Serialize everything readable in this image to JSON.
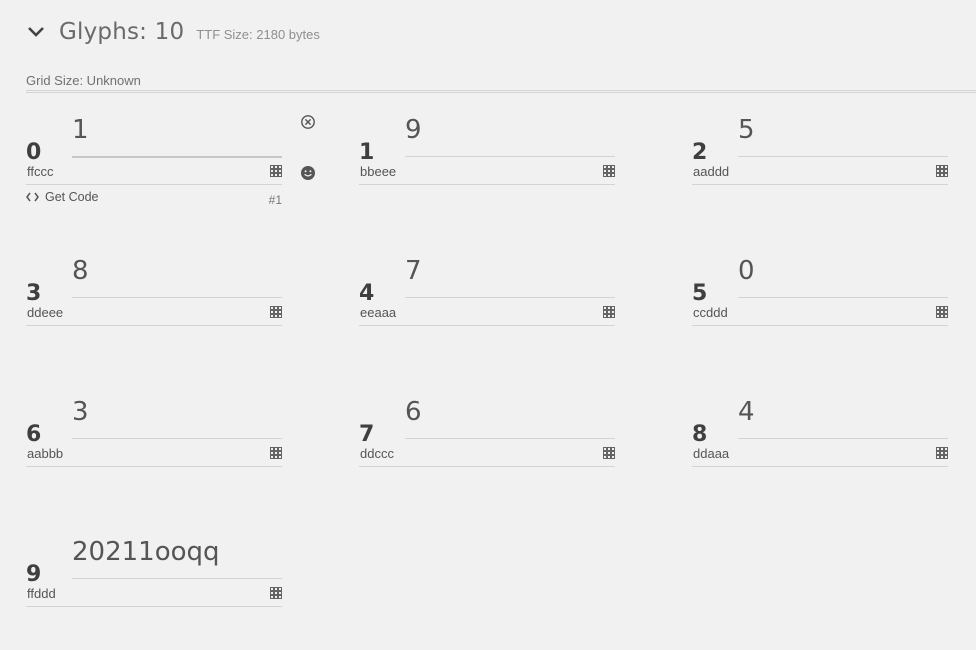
{
  "header": {
    "title": "Glyphs: 10",
    "ttf_size": "TTF Size: 2180 bytes",
    "grid_size": "Grid Size: Unknown"
  },
  "glyphs": [
    {
      "index": "0",
      "char": "1",
      "name": "ffccc",
      "get_code": "Get Code",
      "number": "#1"
    },
    {
      "index": "1",
      "char": "9",
      "name": "bbeee"
    },
    {
      "index": "2",
      "char": "5",
      "name": "aaddd"
    },
    {
      "index": "3",
      "char": "8",
      "name": "ddeee"
    },
    {
      "index": "4",
      "char": "7",
      "name": "eeaaa"
    },
    {
      "index": "5",
      "char": "0",
      "name": "ccddd"
    },
    {
      "index": "6",
      "char": "3",
      "name": "aabbb"
    },
    {
      "index": "7",
      "char": "6",
      "name": "ddccc"
    },
    {
      "index": "8",
      "char": "4",
      "name": "ddaaa"
    },
    {
      "index": "9",
      "char": "20211ooqq",
      "name": "ffddd"
    }
  ],
  "icons": {
    "collapse": "chevron-down-icon",
    "remove": "close-circle-icon",
    "emoji": "smiley-icon",
    "code": "code-icon",
    "pattern": "grid-pattern-icon"
  }
}
